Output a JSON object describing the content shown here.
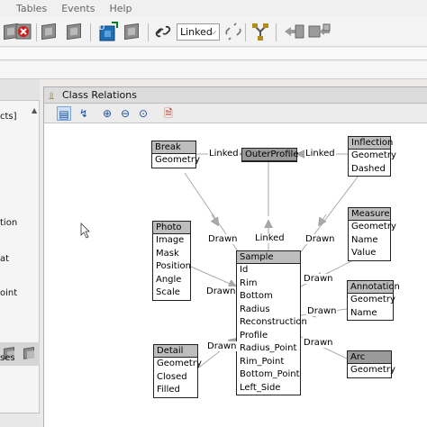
{
  "menubar": {
    "items": [
      "Tables",
      "Events",
      "Help"
    ]
  },
  "toolbar": {
    "link_mode_value": "Linked"
  },
  "left_panel": {
    "lines": [
      "cts]",
      "tion",
      "at",
      "oint",
      "ses"
    ]
  },
  "window": {
    "title": "Class Relations"
  },
  "diagram": {
    "classes": {
      "break": {
        "name": "Break",
        "attributes": [
          "Geometry"
        ]
      },
      "outer_profile": {
        "name": "OuterProfile",
        "attributes": []
      },
      "inflection": {
        "name": "Inflection",
        "attributes": [
          "Geometry",
          "Dashed"
        ]
      },
      "photo": {
        "name": "Photo",
        "attributes": [
          "Image",
          "Mask",
          "Position",
          "Angle",
          "Scale"
        ]
      },
      "measure": {
        "name": "Measure",
        "attributes": [
          "Geometry",
          "Name",
          "Value"
        ]
      },
      "sample": {
        "name": "Sample",
        "attributes": [
          "Id",
          "Rim",
          "Bottom",
          "Radius",
          "Reconstruction",
          "Profile",
          "Radius_Point",
          "Rim_Point",
          "Bottom_Point",
          "Left_Side"
        ]
      },
      "annotation": {
        "name": "Annotation",
        "attributes": [
          "Geometry",
          "Name"
        ]
      },
      "detail": {
        "name": "Detail",
        "attributes": [
          "Geometry",
          "Closed",
          "Filled"
        ]
      },
      "arc": {
        "name": "Arc",
        "attributes": [
          "Geometry"
        ]
      }
    },
    "edge_labels": {
      "break_outer": "Linked",
      "outer_inflection": "Linked",
      "outer_sample": "Linked",
      "break_sample": "Drawn",
      "inflection_sample": "Drawn",
      "photo_sample": "Drawn",
      "measure_sample": "Drawn",
      "annotation_sample": "Drawn",
      "detail_sample": "Drawn",
      "arc_sample": "Drawn"
    }
  }
}
